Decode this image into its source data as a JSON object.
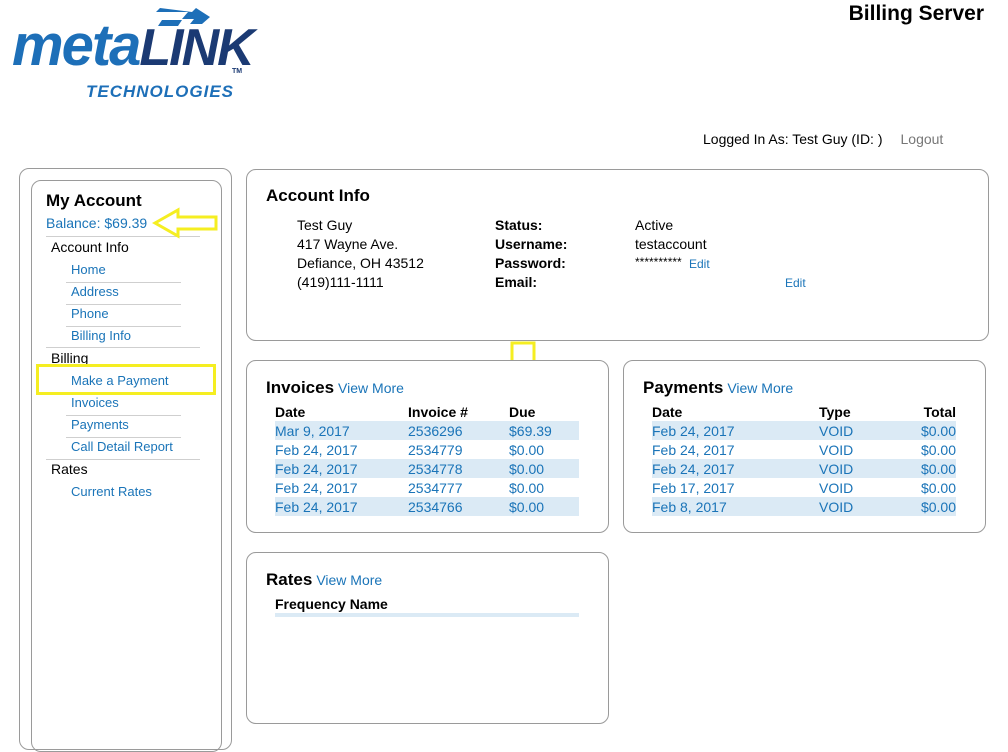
{
  "brand": {
    "logo_meta": "meta",
    "logo_link": "LINK",
    "logo_tm": "TM",
    "logo_sub": "TECHNOLOGIES"
  },
  "header": {
    "title": "Billing Server"
  },
  "login": {
    "text": "Logged In As: Test Guy (ID:         )",
    "logout": "Logout"
  },
  "sidebar": {
    "title": "My Account",
    "balance": "Balance: $69.39",
    "groups": [
      {
        "label": "Account Info",
        "items": [
          "Home",
          "Address",
          "Phone",
          "Billing Info"
        ]
      },
      {
        "label": "Billing",
        "items": [
          "Make a Payment",
          "Invoices",
          "Payments",
          "Call Detail Report"
        ]
      },
      {
        "label": "Rates",
        "items": [
          "Current Rates"
        ]
      }
    ]
  },
  "account": {
    "title": "Account Info",
    "address": [
      "Test Guy",
      "417 Wayne Ave.",
      "Defiance, OH 43512",
      "(419)111-1111"
    ],
    "labels": [
      "Status:",
      "Username:",
      "Password:",
      "Email:"
    ],
    "values": [
      "Active",
      "testaccount",
      "**********",
      ""
    ],
    "edit": "Edit"
  },
  "invoices": {
    "title": "Invoices",
    "view_more": "View More",
    "headers": [
      "Date",
      "Invoice #",
      "Due"
    ],
    "rows": [
      [
        "Mar 9, 2017",
        "2536296",
        "$69.39"
      ],
      [
        "Feb 24, 2017",
        "2534779",
        "$0.00"
      ],
      [
        "Feb 24, 2017",
        "2534778",
        "$0.00"
      ],
      [
        "Feb 24, 2017",
        "2534777",
        "$0.00"
      ],
      [
        "Feb 24, 2017",
        "2534766",
        "$0.00"
      ]
    ]
  },
  "payments": {
    "title": "Payments",
    "view_more": "View More",
    "headers": [
      "Date",
      "Type",
      "Total"
    ],
    "rows": [
      [
        "Feb 24, 2017",
        "VOID",
        "$0.00"
      ],
      [
        "Feb 24, 2017",
        "VOID",
        "$0.00"
      ],
      [
        "Feb 24, 2017",
        "VOID",
        "$0.00"
      ],
      [
        "Feb 17, 2017",
        "VOID",
        "$0.00"
      ],
      [
        "Feb 8, 2017",
        "VOID",
        "$0.00"
      ]
    ]
  },
  "rates": {
    "title": "Rates",
    "view_more": "View More",
    "headers": [
      "Frequency Name"
    ]
  },
  "colors": {
    "link": "#1a74b8",
    "highlight": "#f5ee21",
    "row_alt": "#dbeaf5",
    "brand_blue": "#1d6fb8",
    "brand_navy": "#1b3a73"
  }
}
